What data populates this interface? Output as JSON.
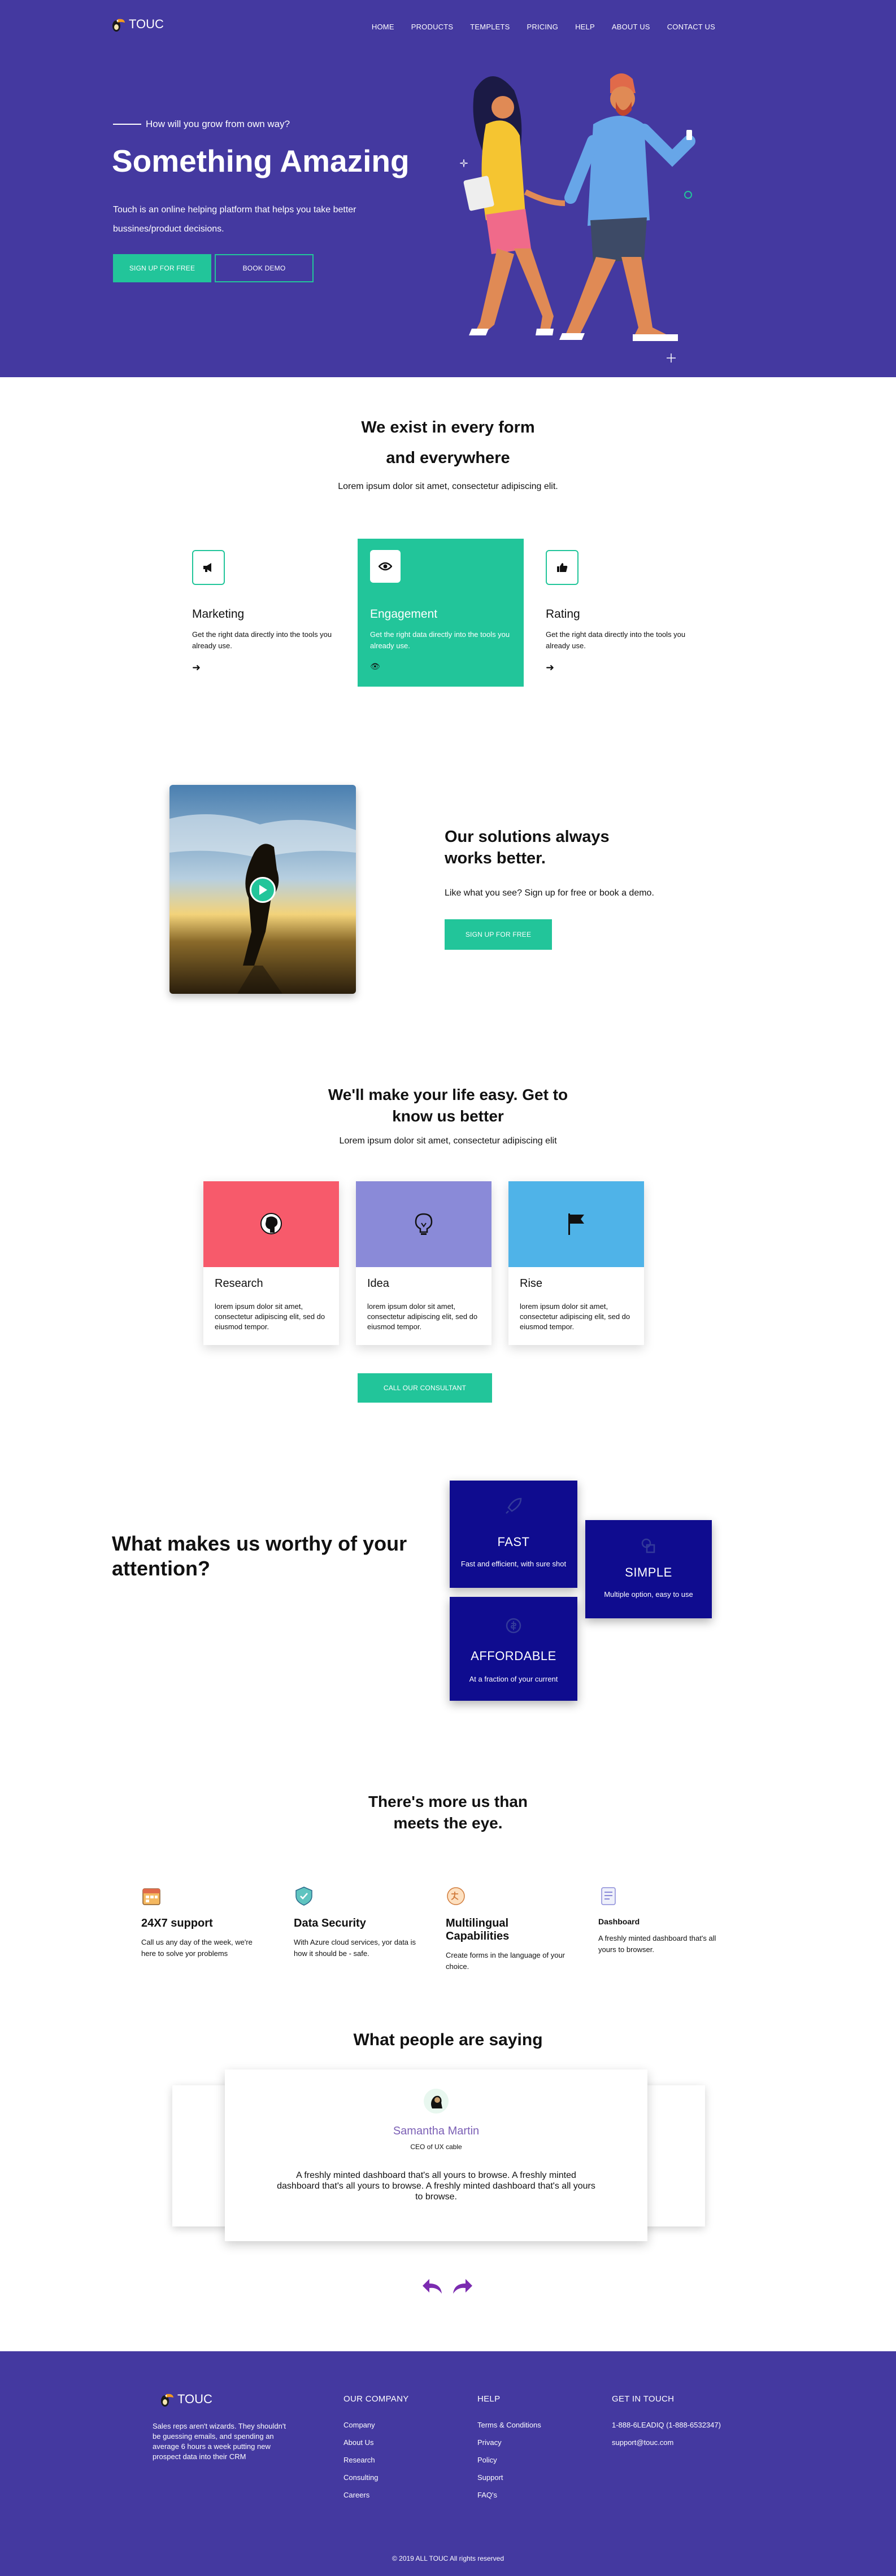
{
  "brand": {
    "name": "TOUC",
    "footer_name": "TOUC"
  },
  "nav": [
    "HOME",
    "PRODUCTS",
    "TEMPLETS",
    "PRICING",
    "HELP",
    "ABOUT US",
    "CONTACT US"
  ],
  "hero": {
    "kicker": "How will you grow from own way?",
    "title": "Something Amazing",
    "description": "Touch is an online helping platform that helps you take better bussines/product decisions.",
    "primary_button": "SIGN UP FOR FREE",
    "secondary_button": "BOOK DEMO"
  },
  "exist": {
    "title_line1": "We exist in every form",
    "title_line2": "and everywhere",
    "subtitle": "Lorem ipsum dolor sit amet, consectetur adipiscing elit.",
    "cards": [
      {
        "title": "Marketing",
        "desc": "Get the right data directly into the tools you already use.",
        "icon": "megaphone-icon"
      },
      {
        "title": "Engagement",
        "desc": "Get the right data directly into the tools you already use.",
        "icon": "eye-icon"
      },
      {
        "title": "Rating",
        "desc": "Get the right data directly into the tools you already use.",
        "icon": "thumbs-up-icon"
      }
    ]
  },
  "solutions": {
    "title_line1": "Our solutions always",
    "title_line2": "works better.",
    "desc": "Like what you see? Sign up for free or book a demo.",
    "button": "SIGN UP FOR FREE"
  },
  "easy": {
    "title_line1": "We'll make your life easy. Get to",
    "title_line2": "know us better",
    "subtitle": "Lorem ipsum dolor sit amet, consectetur adipiscing elit",
    "cards": [
      {
        "title": "Research",
        "desc": "lorem ipsum dolor sit amet, consectetur adipiscing elit, sed do eiusmod tempor.",
        "color": "#f75a6b",
        "icon": "head-icon"
      },
      {
        "title": "Idea",
        "desc": "lorem ipsum dolor sit amet, consectetur adipiscing elit, sed do eiusmod tempor.",
        "color": "#8a8ad8",
        "icon": "lightbulb-icon"
      },
      {
        "title": "Rise",
        "desc": "lorem ipsum dolor sit amet, consectetur adipiscing elit, sed do eiusmod tempor.",
        "color": "#4fb3e8",
        "icon": "flag-icon"
      }
    ],
    "button": "CALL OUR CONSULTANT"
  },
  "worthy": {
    "title_line1": "What makes us worthy of your",
    "title_line2": "attention?",
    "cards": [
      {
        "title": "FAST",
        "desc": "Fast and efficient, with sure shot",
        "icon": "rocket-icon"
      },
      {
        "title": "SIMPLE",
        "desc": "Multiple option, easy to use",
        "icon": "shapes-icon"
      },
      {
        "title": "AFFORDABLE",
        "desc": "At a fraction of your current",
        "icon": "tag-icon"
      }
    ]
  },
  "more": {
    "title_line1": "There's more us than",
    "title_line2": "meets the eye.",
    "items": [
      {
        "title": "24X7 support",
        "desc": "Call us any day of the week, we're here to solve yor problems",
        "icon": "calendar-icon"
      },
      {
        "title": "Data Security",
        "desc": "With Azure cloud services, yor data is how it should be - safe.",
        "icon": "shield-icon"
      },
      {
        "title": "Multilingual Capabilities",
        "desc": "Create forms in the language of your choice.",
        "icon": "language-icon"
      },
      {
        "title": "Dashboard",
        "desc": "A freshly minted dashboard that's all yours to browser.",
        "icon": "dashboard-icon"
      }
    ]
  },
  "testimonials": {
    "title": "What people are saying",
    "name": "Samantha Martin",
    "role": "CEO of UX cable",
    "quote": "A freshly minted dashboard that's all yours to browse. A freshly minted dashboard that's all yours to browse. A freshly minted dashboard that's all yours to browse."
  },
  "footer": {
    "about": "Sales reps aren't wizards. They shouldn't be guessing emails, and spending an average 6 hours a week putting new prospect data into their CRM",
    "company_title": "OUR COMPANY",
    "company_links": [
      "Company",
      "About Us",
      "Research",
      "Consulting",
      "Careers"
    ],
    "help_title": "HELP",
    "help_links": [
      "Terms & Conditions",
      "Privacy",
      "Policy",
      "Support",
      "FAQ's"
    ],
    "contact_title": "GET IN TOUCH",
    "phone": "1-888-6LEADIQ (1-888-6532347)",
    "email": "support@touc.com",
    "copyright": "© 2019 ALL TOUC All rights reserved"
  },
  "colors": {
    "primary": "#4439a0",
    "accent": "#22c59a",
    "deep_blue": "#0f0c8f",
    "link_purple": "#7b5fb5"
  }
}
